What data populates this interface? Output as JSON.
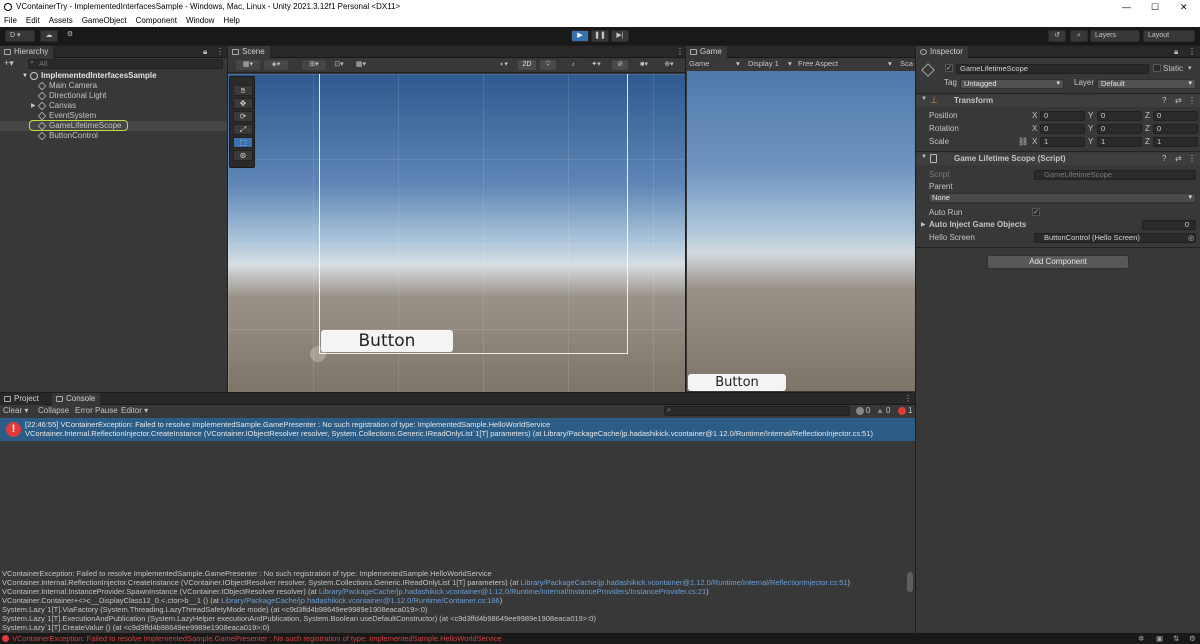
{
  "window": {
    "title": "VContainerTry - ImplementedInterfacesSample - Windows, Mac, Linux - Unity 2021.3.12f1 Personal <DX11>",
    "min": "—",
    "max": "☐",
    "close": "✕"
  },
  "menu": [
    "File",
    "Edit",
    "Assets",
    "GameObject",
    "Component",
    "Window",
    "Help"
  ],
  "toolbar": {
    "account": "D",
    "layers": "Layers",
    "layout": "Layout"
  },
  "hierarchy": {
    "tab": "Hierarchy",
    "search_placeholder": "All",
    "scene_name": "ImplementedInterfacesSample",
    "items": [
      "Main Camera",
      "Directional Light",
      "Canvas",
      "EventSystem",
      "GameLifetimeScope",
      "ButtonControl"
    ]
  },
  "scene": {
    "tab": "Scene",
    "mode_2d": "2D",
    "ui_button": "Button"
  },
  "game": {
    "tab": "Game",
    "mode": "Game",
    "display": "Display 1",
    "aspect": "Free Aspect",
    "scale": "Sca",
    "ui_button": "Button"
  },
  "inspector": {
    "tab": "Inspector",
    "object_name": "GameLifetimeScope",
    "static_label": "Static",
    "tag_label": "Tag",
    "tag_value": "Untagged",
    "layer_label": "Layer",
    "layer_value": "Default",
    "transform": {
      "header": "Transform",
      "position_label": "Position",
      "rotation_label": "Rotation",
      "scale_label": "Scale",
      "x": "X",
      "y": "Y",
      "z": "Z",
      "position": [
        "0",
        "0",
        "0"
      ],
      "rotation": [
        "0",
        "0",
        "0"
      ],
      "scale": [
        "1",
        "1",
        "1"
      ]
    },
    "script_comp": {
      "header": "Game Lifetime Scope (Script)",
      "script_label": "Script",
      "script_value": "GameLifetimeScope",
      "parent_label": "Parent",
      "parent_value": "None",
      "auto_run_label": "Auto Run",
      "auto_inject_label": "Auto Inject Game Objects",
      "auto_inject_value": "0",
      "hello_label": "Hello Screen",
      "hello_value": "ButtonControl (Hello Screen)"
    },
    "add_component": "Add Component"
  },
  "console": {
    "tab_project": "Project",
    "tab_console": "Console",
    "clear": "Clear",
    "collapse": "Collapse",
    "error_pause": "Error Pause",
    "editor": "Editor",
    "count_info": "0",
    "count_warn": "0",
    "count_error": "1",
    "entry_line1": "[22:46:55] VContainerException: Failed to resolve ImplementedSample.GamePresenter : No such registration of type: ImplementedSample.HelloWorldService",
    "entry_line2": "VContainer.Internal.ReflectionInjector.CreateInstance (VContainer.IObjectResolver resolver, System.Collections.Generic.IReadOnlyList`1[T] parameters) (at Library/PackageCache/jp.hadashikick.vcontainer@1.12.0/Runtime/Internal/ReflectionInjector.cs:51)",
    "detail": [
      {
        "text": "VContainerException: Failed to resolve ImplementedSample.GamePresenter : No such registration of type: ImplementedSample.HelloWorldService",
        "link": ""
      },
      {
        "text": "VContainer.Internal.ReflectionInjector.CreateInstance (VContainer.IObjectResolver resolver, System.Collections.Generic.IReadOnlyList`1[T] parameters) (at ",
        "link": "Library/PackageCache/jp.hadashikick.vcontainer@1.12.0/Runtime/Internal/ReflectionInjector.cs:51",
        "tail": ")"
      },
      {
        "text": "VContainer.Internal.InstanceProvider.SpawnInstance (VContainer.IObjectResolver resolver) (at ",
        "link": "Library/PackageCache/jp.hadashikick.vcontainer@1.12.0/Runtime/Internal/InstanceProviders/InstanceProvider.cs:21",
        "tail": ")"
      },
      {
        "text": "VContainer.Container+<>c__DisplayClass12_0.<.ctor>b__1 () (at ",
        "link": "Library/PackageCache/jp.hadashikick.vcontainer@1.12.0/Runtime/Container.cs:186",
        "tail": ")"
      },
      {
        "text": "System.Lazy`1[T].ViaFactory (System.Threading.LazyThreadSafetyMode mode) (at <c9d3ffd4b98649ee9989e1908eaca019>:0)",
        "link": ""
      },
      {
        "text": "System.Lazy`1[T].ExecutionAndPublication (System.LazyHelper executionAndPublication, System.Boolean useDefaultConstructor) (at <c9d3ffd4b98649ee9989e1908eaca019>:0)",
        "link": ""
      },
      {
        "text": "System.Lazy`1[T].CreateValue () (at <c9d3ffd4b98649ee9989e1908eaca019>:0)",
        "link": ""
      }
    ]
  },
  "statusbar": {
    "message": "VContainerException: Failed to resolve ImplementedSample.GamePresenter : No such registration of type: ImplementedSample.HelloWorldService"
  },
  "colors": {
    "error": "#e03a3a",
    "selection": "#2c5d87",
    "accent": "#4c7fff"
  }
}
